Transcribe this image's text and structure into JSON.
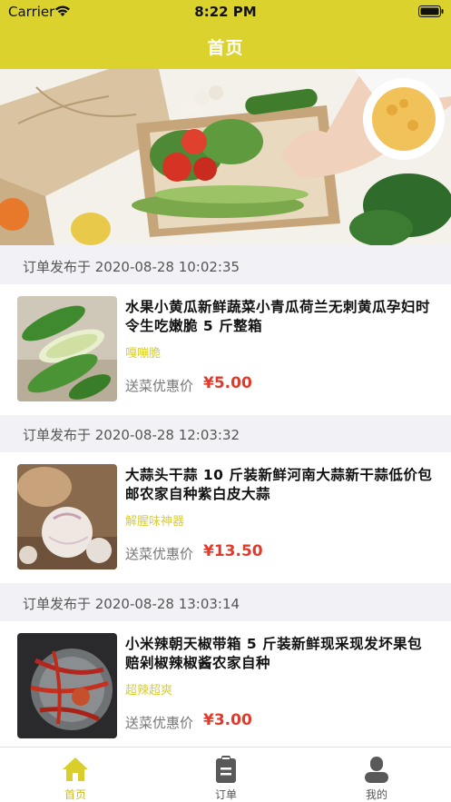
{
  "status_bar": {
    "carrier": "Carrier",
    "time": "8:22 PM"
  },
  "nav": {
    "title": "首页"
  },
  "orders": [
    {
      "published": "订单发布于 2020-08-28 10:02:35",
      "title": "水果小黄瓜新鲜蔬菜小青瓜荷兰无刺黄瓜孕妇时令生吃嫩脆 5 斤整箱",
      "tag": "嘎嘣脆",
      "price_label": "送菜优惠价",
      "price": "¥5.00",
      "image": "cucumbers-image"
    },
    {
      "published": "订单发布于 2020-08-28 12:03:32",
      "title": "大蒜头干蒜 10 斤装新鲜河南大蒜新干蒜低价包邮农家自种紫白皮大蒜",
      "tag": "解腥味神器",
      "price_label": "送菜优惠价",
      "price": "¥13.50",
      "image": "garlic-image"
    },
    {
      "published": "订单发布于 2020-08-28 13:03:14",
      "title": "小米辣朝天椒带箱 5 斤装新鲜现采现发坏果包赔剁椒辣椒酱农家自种",
      "tag": "超辣超爽",
      "price_label": "送菜优惠价",
      "price": "¥3.00",
      "image": "chili-image"
    }
  ],
  "tabs": [
    {
      "label": "首页",
      "icon": "home-icon",
      "active": true
    },
    {
      "label": "订单",
      "icon": "clipboard-icon",
      "active": false
    },
    {
      "label": "我的",
      "icon": "person-icon",
      "active": false
    }
  ],
  "colors": {
    "accent": "#dcd22e",
    "price": "#e23a2a",
    "tag": "#d9cf2c"
  }
}
